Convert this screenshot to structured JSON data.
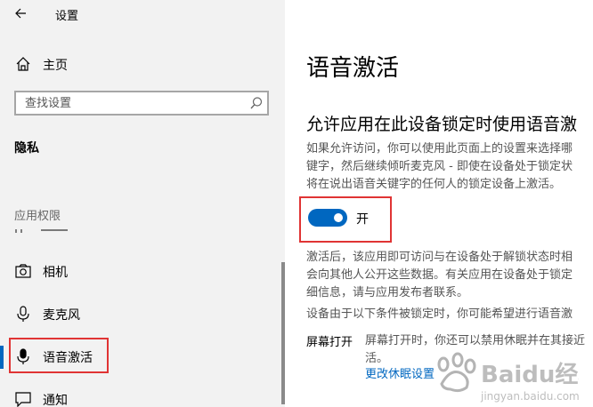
{
  "window": {
    "title": "设置"
  },
  "sidebar": {
    "home_label": "主页",
    "search_placeholder": "查找设置",
    "section_title": "隐私",
    "group_label": "应用权限",
    "items": [
      {
        "label": "相机",
        "icon": "camera-icon"
      },
      {
        "label": "麦克风",
        "icon": "microphone-icon"
      },
      {
        "label": "语音激活",
        "icon": "microphone-icon",
        "active": true
      },
      {
        "label": "通知",
        "icon": "notification-icon"
      }
    ],
    "accent_color": "#0067c0"
  },
  "main": {
    "title": "语音激活",
    "subheading": "允许应用在此设备锁定时使用语音激",
    "intro_lines": [
      "如果允许访问，你可以使用此页面上的设置来选择哪",
      "键字，然后继续倾听麦克风 - 即使在设备处于锁定状",
      "将在说出语音关键字的任何人的锁定设备上激活。"
    ],
    "toggle": {
      "label": "开",
      "on": true
    },
    "detail_lines": [
      "激活后，该应用即可访问与在设备处于解锁状态时相",
      "会向其他人公开这些数据。有关应用在设备处于锁定",
      "细信息，请与应用发布者联系。"
    ],
    "condition_text": "设备由于以下条件被锁定时，你可能希望进行语音激",
    "screen_row": {
      "label": "屏幕打开",
      "desc_lines": [
        "屏幕打开时，你还可以禁用休眠并在其接近",
        "活。"
      ],
      "link": "更改休眠设置"
    }
  },
  "watermark": {
    "text": "Baidu经验",
    "subtext": "jingyan.baidu.com"
  }
}
